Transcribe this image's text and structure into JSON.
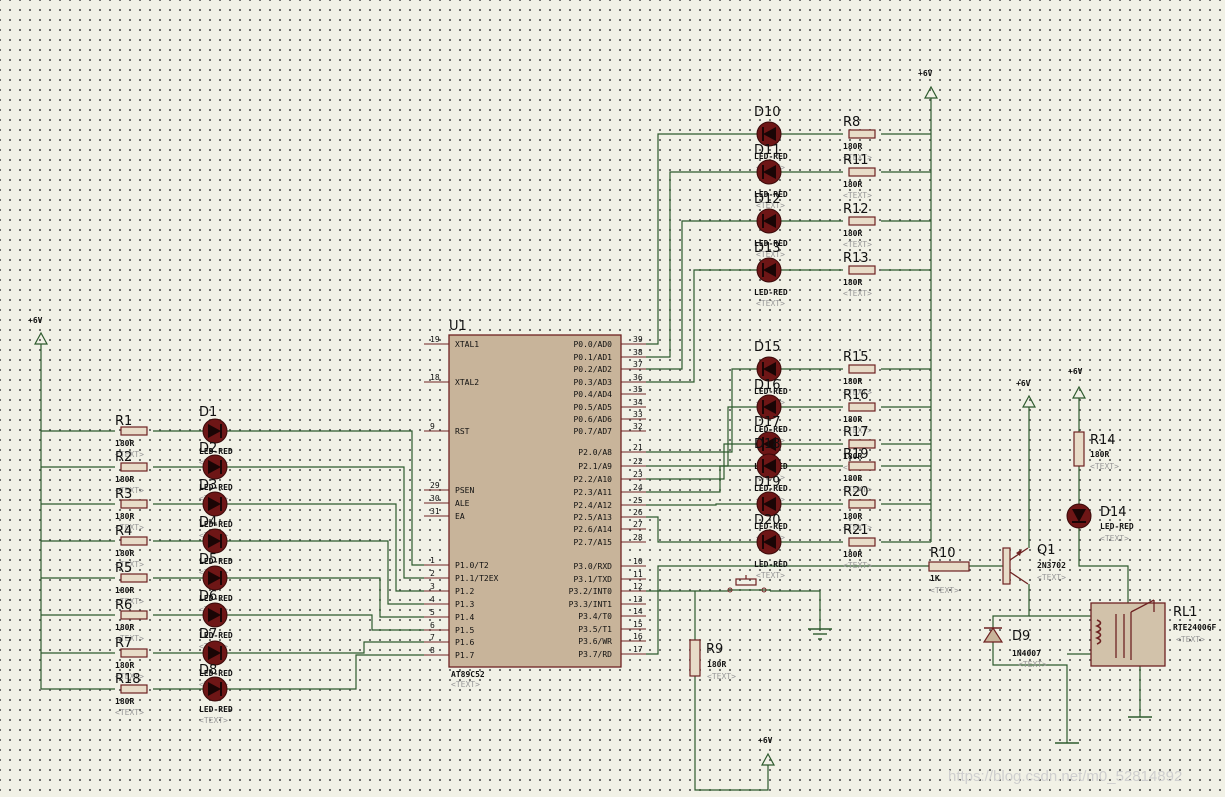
{
  "power_label": "+6V",
  "led_value": "LED-RED",
  "resistor_value": "180R",
  "text_placeholder": "<TEXT>",
  "mcu": {
    "ref": "U1",
    "part": "AT89C52",
    "left_pins": [
      {
        "num": "19",
        "name": "XTAL1"
      },
      {
        "num": "18",
        "name": "XTAL2"
      },
      {
        "num": "9",
        "name": "RST"
      },
      {
        "num": "29",
        "name": "PSEN"
      },
      {
        "num": "30",
        "name": "ALE"
      },
      {
        "num": "31",
        "name": "EA"
      },
      {
        "num": "1",
        "name": "P1.0/T2"
      },
      {
        "num": "2",
        "name": "P1.1/T2EX"
      },
      {
        "num": "3",
        "name": "P1.2"
      },
      {
        "num": "4",
        "name": "P1.3"
      },
      {
        "num": "5",
        "name": "P1.4"
      },
      {
        "num": "6",
        "name": "P1.5"
      },
      {
        "num": "7",
        "name": "P1.6"
      },
      {
        "num": "8",
        "name": "P1.7"
      }
    ],
    "right_pins": [
      {
        "num": "39",
        "name": "P0.0/AD0"
      },
      {
        "num": "38",
        "name": "P0.1/AD1"
      },
      {
        "num": "37",
        "name": "P0.2/AD2"
      },
      {
        "num": "36",
        "name": "P0.3/AD3"
      },
      {
        "num": "35",
        "name": "P0.4/AD4"
      },
      {
        "num": "34",
        "name": "P0.5/AD5"
      },
      {
        "num": "33",
        "name": "P0.6/AD6"
      },
      {
        "num": "32",
        "name": "P0.7/AD7"
      },
      {
        "num": "21",
        "name": "P2.0/A8"
      },
      {
        "num": "22",
        "name": "P2.1/A9"
      },
      {
        "num": "23",
        "name": "P2.2/A10"
      },
      {
        "num": "24",
        "name": "P2.3/A11"
      },
      {
        "num": "25",
        "name": "P2.4/A12"
      },
      {
        "num": "26",
        "name": "P2.5/A13"
      },
      {
        "num": "27",
        "name": "P2.6/A14"
      },
      {
        "num": "28",
        "name": "P2.7/A15"
      },
      {
        "num": "10",
        "name": "P3.0/RXD"
      },
      {
        "num": "11",
        "name": "P3.1/TXD"
      },
      {
        "num": "12",
        "name": "P3.2/INT0"
      },
      {
        "num": "13",
        "name": "P3.3/INT1"
      },
      {
        "num": "14",
        "name": "P3.4/T0"
      },
      {
        "num": "15",
        "name": "P3.5/T1"
      },
      {
        "num": "16",
        "name": "P3.6/WR"
      },
      {
        "num": "17",
        "name": "P3.7/RD"
      }
    ]
  },
  "left_resistors": [
    "R1",
    "R2",
    "R3",
    "R4",
    "R5",
    "R6",
    "R7",
    "R18"
  ],
  "left_leds": [
    "D1",
    "D2",
    "D3",
    "D4",
    "D5",
    "D6",
    "D7",
    "D8"
  ],
  "top_leds": [
    "D10",
    "D11",
    "D12",
    "D13"
  ],
  "top_resistors": [
    "R8",
    "R11",
    "R12",
    "R13"
  ],
  "mid_leds": [
    "D15",
    "D16",
    "D17",
    "D18",
    "D19",
    "D20"
  ],
  "mid_resistors": [
    "R15",
    "R16",
    "R17",
    "R19",
    "R20",
    "R21"
  ],
  "r10": {
    "ref": "R10",
    "value": "1K"
  },
  "r9": {
    "ref": "R9",
    "value": "180R"
  },
  "r14": {
    "ref": "R14",
    "value": "180R"
  },
  "d14": {
    "ref": "D14",
    "value": "LED-RED"
  },
  "q1": {
    "ref": "Q1",
    "value": "2N3702"
  },
  "d9": {
    "ref": "D9",
    "value": "1N4007"
  },
  "rl1": {
    "ref": "RL1",
    "value": "RTE24006F"
  },
  "watermark": "https://blog.csdn.net/m0_52814892"
}
